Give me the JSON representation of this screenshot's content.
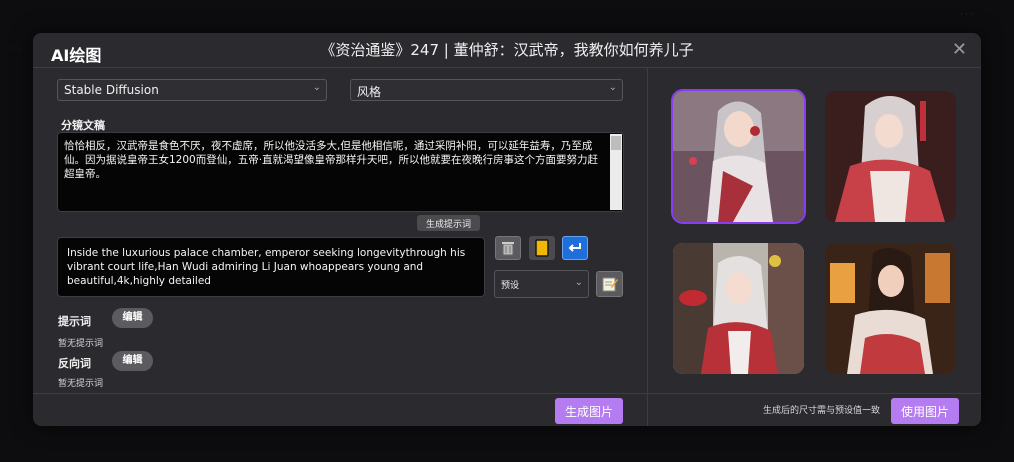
{
  "modal": {
    "app_title": "AI绘图",
    "doc_title": "《资治通鉴》247 | 董仲舒：汉武帝，我教你如何养儿子",
    "close_glyph": "✕"
  },
  "controls": {
    "model_select": "Stable Diffusion",
    "style_select": "风格",
    "script_label": "分镜文稿",
    "script_text": "恰恰相反，汉武帝是食色不厌，夜不虚席，所以他没活多大,但是他相信呢，通过采阴补阳，可以延年益寿，乃至成仙。因为据说皇帝王女1200而登仙，五帝·直就渴望像皇帝那样升天吧，所以他就要在夜晚行房事这个方面要努力赶超皇帝。",
    "generate_prompt_button": "生成提示词",
    "prompt_text": "Inside the luxurious palace chamber, emperor seeking longevitythrough his vibrant court life,Han Wudi admiring Li Juan whoappears young and beautiful,4k,highly detailed",
    "preset_select": "预设",
    "positive_label": "提示词",
    "positive_edit": "编辑",
    "positive_empty": "暂无提示词",
    "negative_label": "反向词",
    "negative_edit": "编辑",
    "negative_empty": "暂无提示词",
    "generate_image_button": "生成图片"
  },
  "icons": {
    "trash": "trash-icon",
    "copy": "copy-icon",
    "return": "return-icon",
    "edit_note": "edit-note-icon"
  },
  "right": {
    "size_note": "生成后的尺寸需与预设值一致",
    "use_image_button": "使用图片",
    "selected_index": 0
  },
  "colors": {
    "accent": "#b57bf0",
    "selection": "#8a3cf0",
    "copy_icon": "#f2b705",
    "return_icon": "#1e6fd9"
  }
}
